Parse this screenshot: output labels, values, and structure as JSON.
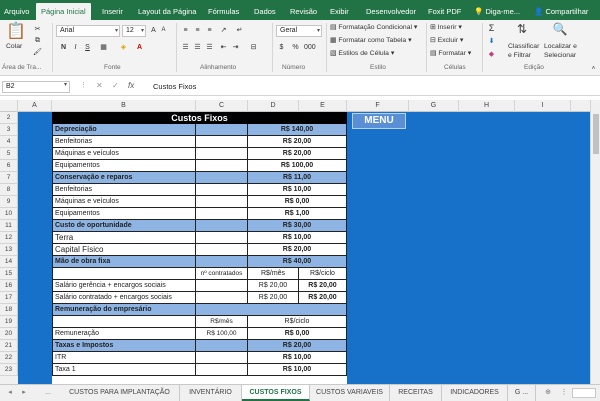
{
  "tabs": [
    "Arquivo",
    "Página Inicial",
    "Inserir",
    "Layout da Página",
    "Fórmulas",
    "Dados",
    "Revisão",
    "Exibir",
    "Desenvolvedor",
    "Foxit PDF"
  ],
  "tell_me": "Diga-me...",
  "share": "Compartilhar",
  "ribbon": {
    "paste": "Colar",
    "font_name": "Arial",
    "font_size": "12",
    "number_format": "Geral",
    "cond_format": "Formatação Condicional",
    "format_table": "Formatar como Tabela",
    "cell_styles": "Estilos de Célula",
    "insert": "Inserir",
    "delete": "Excluir",
    "format": "Formatar",
    "sort_filter_1": "Classificar",
    "sort_filter_2": "e Filtrar",
    "find_select_1": "Localizar e",
    "find_select_2": "Selecionar",
    "groups": [
      "Área de Tra...",
      "Fonte",
      "Alinhamento",
      "Número",
      "Estilo",
      "Células",
      "Edição"
    ]
  },
  "formula_bar": {
    "name_box": "B2",
    "fx": "fx",
    "content": "Custos Fixos"
  },
  "columns": [
    "A",
    "B",
    "C",
    "D",
    "E",
    "F",
    "G",
    "H",
    "I"
  ],
  "rows": [
    "2",
    "3",
    "4",
    "5",
    "6",
    "7",
    "8",
    "9",
    "10",
    "11",
    "12",
    "13",
    "14",
    "15",
    "16",
    "17",
    "18",
    "19",
    "20",
    "21",
    "22",
    "23"
  ],
  "table": {
    "title": "Custos Fixos",
    "r3": {
      "label": "Depreciação",
      "value": "R$ 140,00"
    },
    "r4": {
      "label": "Benfeitorias",
      "value": "R$ 20,00"
    },
    "r5": {
      "label": "Máquinas e veículos",
      "value": "R$ 20,00"
    },
    "r6": {
      "label": "Equipamentos",
      "value": "R$ 100,00"
    },
    "r7": {
      "label": "Conservação e reparos",
      "value": "R$ 11,00"
    },
    "r8": {
      "label": "Benfeitorias",
      "value": "R$ 10,00"
    },
    "r9": {
      "label": "Máquinas e veículos",
      "value": "R$ 0,00"
    },
    "r10": {
      "label": "Equipamentos",
      "value": "R$ 1,00"
    },
    "r11": {
      "label": "Custo de oportunidade",
      "value": "R$ 30,00"
    },
    "r12": {
      "label": "Terra",
      "value": "R$ 10,00"
    },
    "r13": {
      "label": "Capital Físico",
      "value": "R$ 20,00"
    },
    "r14": {
      "label": "Mão de obra fixa",
      "value": "R$ 40,00"
    },
    "r15": {
      "c": "nº contratados",
      "d": "R$/mês",
      "e": "R$/ciclo"
    },
    "r16": {
      "label": "Salário gerência + encargos sociais",
      "d": "R$ 20,00",
      "e": "R$ 20,00"
    },
    "r17": {
      "label": "Salário contratado + encargos sociais",
      "d": "R$ 20,00",
      "e": "R$ 20,00"
    },
    "r18": {
      "label": "Remuneração do empresário"
    },
    "r19": {
      "c": "R$/mês",
      "de": "R$/ciclo"
    },
    "r20": {
      "label": "Remuneração",
      "c": "R$ 100,00",
      "de": "R$ 0,00"
    },
    "r21": {
      "label": "Taxas e Impostos",
      "value": "R$ 20,00"
    },
    "r22": {
      "label": "ITR",
      "value": "R$ 10,00"
    },
    "r23": {
      "label": "Taxa 1",
      "value": "R$ 10,00"
    }
  },
  "menu_button": "MENU",
  "sheet_tabs": [
    "CUSTOS PARA IMPLANTAÇÃO",
    "INVENTÁRIO",
    "CUSTOS FIXOS",
    "CUSTOS VARIAVEIS",
    "RECEITAS",
    "INDICADORES",
    "G ..."
  ],
  "sheet_nav": [
    "◂",
    "▸",
    "..."
  ],
  "active_sheet": "CUSTOS FIXOS",
  "colors": {
    "excel_green": "#217346",
    "sheet_blue": "#1871c8",
    "section_blue": "#8db4e2"
  }
}
